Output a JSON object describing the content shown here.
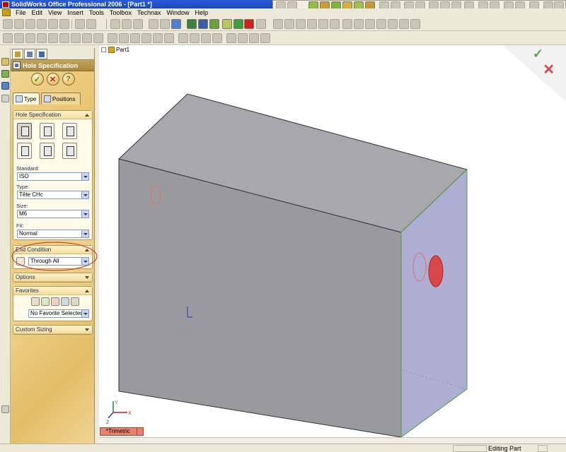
{
  "window": {
    "title": "SolidWorks Office Professional 2006 - [Part1 *]"
  },
  "menu": {
    "items": [
      "File",
      "Edit",
      "View",
      "Insert",
      "Tools",
      "Toolbox",
      "Technax",
      "Window",
      "Help"
    ]
  },
  "panel": {
    "title": "Hole Specification",
    "buttons": {
      "ok": "✓",
      "cancel": "✕",
      "help": "?"
    },
    "tabs": {
      "type": "Type",
      "positions": "Positions"
    },
    "hole_spec": {
      "title": "Hole Specification",
      "standard_label": "Standard:",
      "standard_value": "ISO",
      "type_label": "Type:",
      "type_value": "Tête CHc",
      "size_label": "Size:",
      "size_value": "M6",
      "fit_label": "Fit:",
      "fit_value": "Normal"
    },
    "end_condition": {
      "title": "End Condition",
      "value": "Through All"
    },
    "options": {
      "title": "Options"
    },
    "favorites": {
      "title": "Favorites",
      "value": "No Favorite Selected"
    },
    "custom_sizing": {
      "title": "Custom Sizing"
    }
  },
  "viewport": {
    "tree_root": "Part1",
    "confirm_ok": "✓",
    "confirm_cancel": "✕",
    "axis_labels": {
      "x": "X",
      "y": "Y",
      "z": "Z"
    }
  },
  "view_orientation": "*Trimetric",
  "status": {
    "text": "Editing Part"
  },
  "colors": {
    "highlight_ellipse": "#c0302a",
    "front_face": "#9a9a9e",
    "top_face": "#a8a8ac",
    "side_face": "#aeaed2",
    "hole_red": "#d84848"
  }
}
